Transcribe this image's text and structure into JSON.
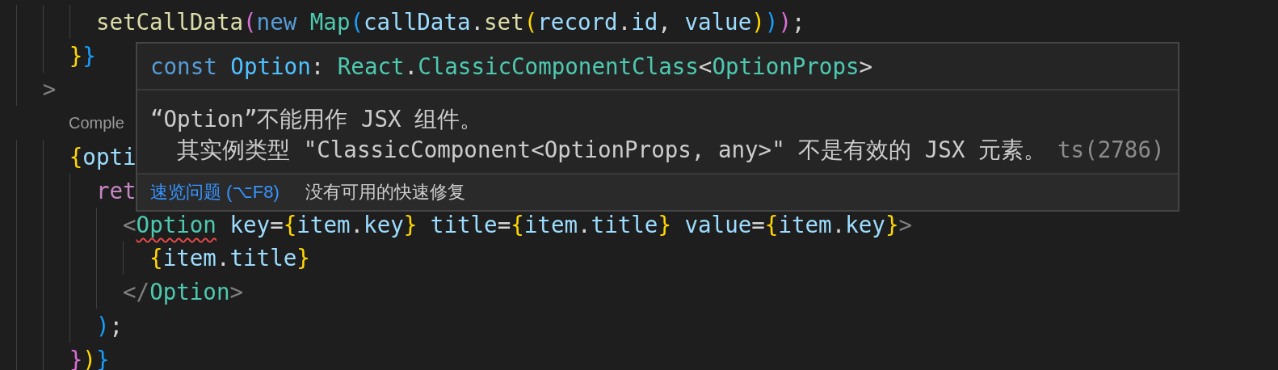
{
  "editor": {
    "lines": [
      {
        "kind": "code",
        "tokens": [
          {
            "text": "       setCallData",
            "kind": "func"
          },
          {
            "text": "(",
            "kind": "bracket2"
          },
          {
            "text": "new ",
            "kind": "keyword"
          },
          {
            "text": "Map",
            "kind": "type"
          },
          {
            "text": "(",
            "kind": "bracket3"
          },
          {
            "text": "callData",
            "kind": "var"
          },
          {
            "text": ".",
            "kind": "punct"
          },
          {
            "text": "set",
            "kind": "func"
          },
          {
            "text": "(",
            "kind": "bracket1"
          },
          {
            "text": "record",
            "kind": "var"
          },
          {
            "text": ".",
            "kind": "punct"
          },
          {
            "text": "id",
            "kind": "var"
          },
          {
            "text": ", ",
            "kind": "punct"
          },
          {
            "text": "value",
            "kind": "var"
          },
          {
            "text": ")",
            "kind": "bracket1"
          },
          {
            "text": ")",
            "kind": "bracket3"
          },
          {
            "text": ")",
            "kind": "bracket2"
          },
          {
            "text": ";",
            "kind": "punct"
          }
        ]
      },
      {
        "kind": "code",
        "tokens": [
          {
            "text": "     }",
            "kind": "bracket1"
          },
          {
            "text": "}",
            "kind": "bracket3"
          }
        ]
      },
      {
        "kind": "code",
        "tokens": [
          {
            "text": "   >",
            "kind": "tagpunct"
          }
        ]
      },
      {
        "kind": "codelens",
        "text": "Comple"
      },
      {
        "kind": "code",
        "tokens": [
          {
            "text": "     {",
            "kind": "bracket1"
          },
          {
            "text": "opti",
            "kind": "var"
          }
        ]
      },
      {
        "kind": "code",
        "tokens": [
          {
            "text": "       ret",
            "kind": "control"
          }
        ]
      },
      {
        "kind": "code",
        "tokens": [
          {
            "text": "         <",
            "kind": "tagpunct"
          },
          {
            "text": "Option",
            "kind": "type",
            "error": true
          },
          {
            "text": " key",
            "kind": "var"
          },
          {
            "text": "=",
            "kind": "punct"
          },
          {
            "text": "{",
            "kind": "bracket1"
          },
          {
            "text": "item",
            "kind": "var"
          },
          {
            "text": ".",
            "kind": "punct"
          },
          {
            "text": "key",
            "kind": "var"
          },
          {
            "text": "}",
            "kind": "bracket1"
          },
          {
            "text": " title",
            "kind": "var"
          },
          {
            "text": "=",
            "kind": "punct"
          },
          {
            "text": "{",
            "kind": "bracket1"
          },
          {
            "text": "item",
            "kind": "var"
          },
          {
            "text": ".",
            "kind": "punct"
          },
          {
            "text": "title",
            "kind": "var"
          },
          {
            "text": "}",
            "kind": "bracket1"
          },
          {
            "text": " value",
            "kind": "var"
          },
          {
            "text": "=",
            "kind": "punct"
          },
          {
            "text": "{",
            "kind": "bracket1"
          },
          {
            "text": "item",
            "kind": "var"
          },
          {
            "text": ".",
            "kind": "punct"
          },
          {
            "text": "key",
            "kind": "var"
          },
          {
            "text": "}",
            "kind": "bracket1"
          },
          {
            "text": ">",
            "kind": "tagpunct"
          }
        ]
      },
      {
        "kind": "code",
        "tokens": [
          {
            "text": "           {",
            "kind": "bracket1"
          },
          {
            "text": "item",
            "kind": "var"
          },
          {
            "text": ".",
            "kind": "punct"
          },
          {
            "text": "title",
            "kind": "var"
          },
          {
            "text": "}",
            "kind": "bracket1"
          }
        ]
      },
      {
        "kind": "code",
        "tokens": [
          {
            "text": "         </",
            "kind": "tagpunct"
          },
          {
            "text": "Option",
            "kind": "type"
          },
          {
            "text": ">",
            "kind": "tagpunct"
          }
        ]
      },
      {
        "kind": "code",
        "tokens": [
          {
            "text": "       )",
            "kind": "bracket3"
          },
          {
            "text": ";",
            "kind": "punct"
          }
        ]
      },
      {
        "kind": "code",
        "tokens": [
          {
            "text": "     }",
            "kind": "bracket2"
          },
          {
            "text": ")",
            "kind": "bracket1"
          },
          {
            "text": "}",
            "kind": "bracket3"
          }
        ]
      }
    ]
  },
  "hover": {
    "signature": [
      {
        "text": "const ",
        "kind": "keyword"
      },
      {
        "text": "Option",
        "kind": "const"
      },
      {
        "text": ": ",
        "kind": "punct"
      },
      {
        "text": "React",
        "kind": "type"
      },
      {
        "text": ".",
        "kind": "punct"
      },
      {
        "text": "ClassicComponentClass",
        "kind": "type"
      },
      {
        "text": "<",
        "kind": "punct"
      },
      {
        "text": "OptionProps",
        "kind": "type"
      },
      {
        "text": ">",
        "kind": "punct"
      }
    ],
    "message": "“Option”不能用作 JSX 组件。",
    "detail": "  其实例类型 \"ClassicComponent<OptionProps, any>\" 不是有效的 JSX 元素。",
    "code": "ts(2786)",
    "peek_link": "速览问题 (⌥F8)",
    "quick_fix": "没有可用的快速修复"
  }
}
